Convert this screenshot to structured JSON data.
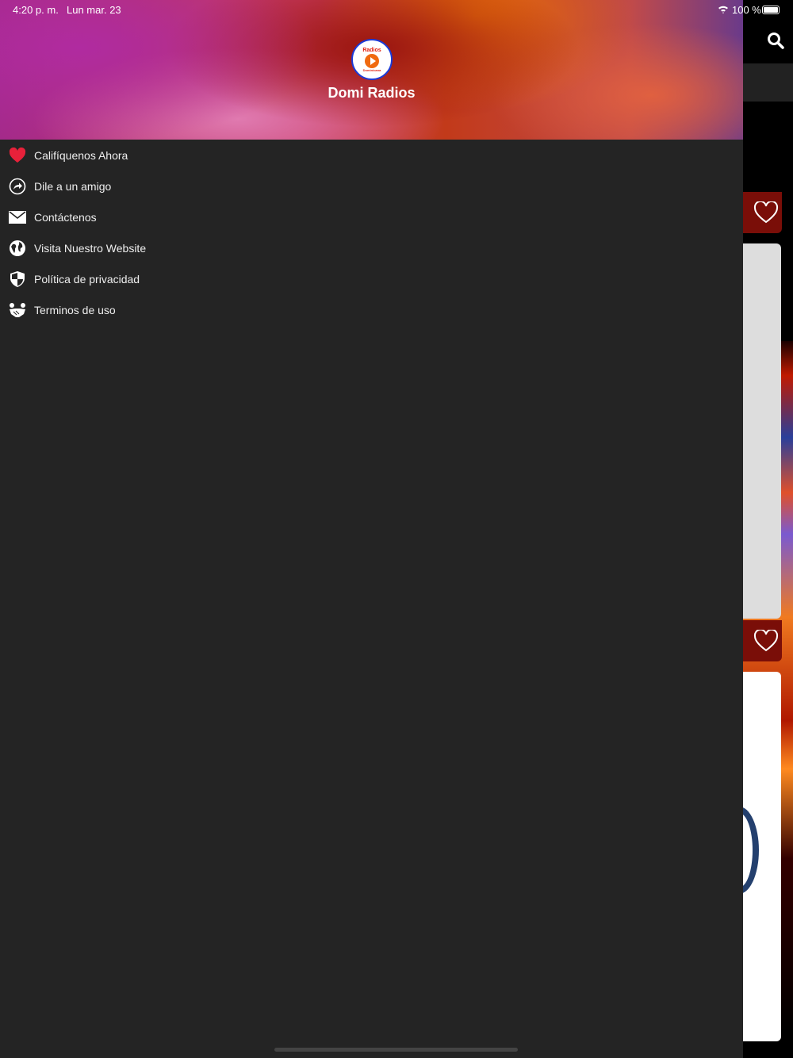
{
  "status_bar": {
    "time": "4:20 p. m.",
    "date": "Lun mar. 23",
    "battery": "100 %"
  },
  "header": {
    "app_title": "Domi Radios",
    "logo_text_top": "Radios",
    "logo_text_bottom": "Dominicana"
  },
  "menu": {
    "items": [
      {
        "label": "Califíquenos Ahora",
        "icon": "heart-icon"
      },
      {
        "label": "Dile a un amigo",
        "icon": "share-icon"
      },
      {
        "label": "Contáctenos",
        "icon": "mail-icon"
      },
      {
        "label": "Visita Nuestro Website",
        "icon": "globe-icon"
      },
      {
        "label": "Política de privacidad",
        "icon": "shield-icon"
      },
      {
        "label": "Terminos de uso",
        "icon": "handshake-icon"
      }
    ]
  },
  "colors": {
    "drawer_bg": "#242424",
    "heart_red": "#e8213a",
    "favorite_tab": "#7a0e08"
  }
}
